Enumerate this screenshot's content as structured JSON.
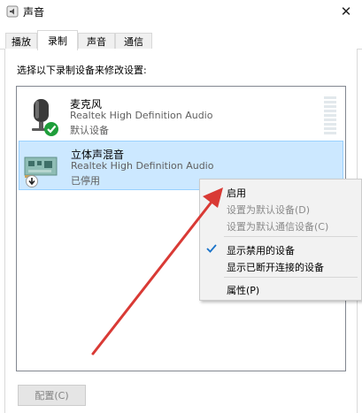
{
  "window": {
    "title": "声音",
    "close_glyph": "✕",
    "icon": "speaker-icon"
  },
  "tabs": [
    {
      "label": "播放",
      "active": false
    },
    {
      "label": "录制",
      "active": true
    },
    {
      "label": "声音",
      "active": false
    },
    {
      "label": "通信",
      "active": false
    }
  ],
  "instruction": "选择以下录制设备来修改设置:",
  "devices": [
    {
      "name": "麦克风",
      "driver": "Realtek High Definition Audio",
      "status": "默认设备",
      "icon": "microphone-icon",
      "badge": "default-check-icon",
      "selected": false
    },
    {
      "name": "立体声混音",
      "driver": "Realtek High Definition Audio",
      "status": "已停用",
      "icon": "sound-card-icon",
      "badge": "disabled-arrow-icon",
      "selected": true
    }
  ],
  "context_menu": {
    "items": [
      {
        "label": "启用",
        "enabled": true
      },
      {
        "label": "设置为默认设备(D)",
        "enabled": false
      },
      {
        "label": "设置为默认通信设备(C)",
        "enabled": false
      },
      {
        "label": "显示禁用的设备",
        "enabled": true,
        "checked": true
      },
      {
        "label": "显示已断开连接的设备",
        "enabled": true
      },
      {
        "label": "属性(P)",
        "enabled": true
      }
    ]
  },
  "configure_button": {
    "label": "配置(C)",
    "enabled": false
  },
  "colors": {
    "selection": "#cce8ff",
    "annotation_arrow": "#d93a35",
    "check_green": "#1e9e3a",
    "menu_check": "#1a73c9"
  }
}
